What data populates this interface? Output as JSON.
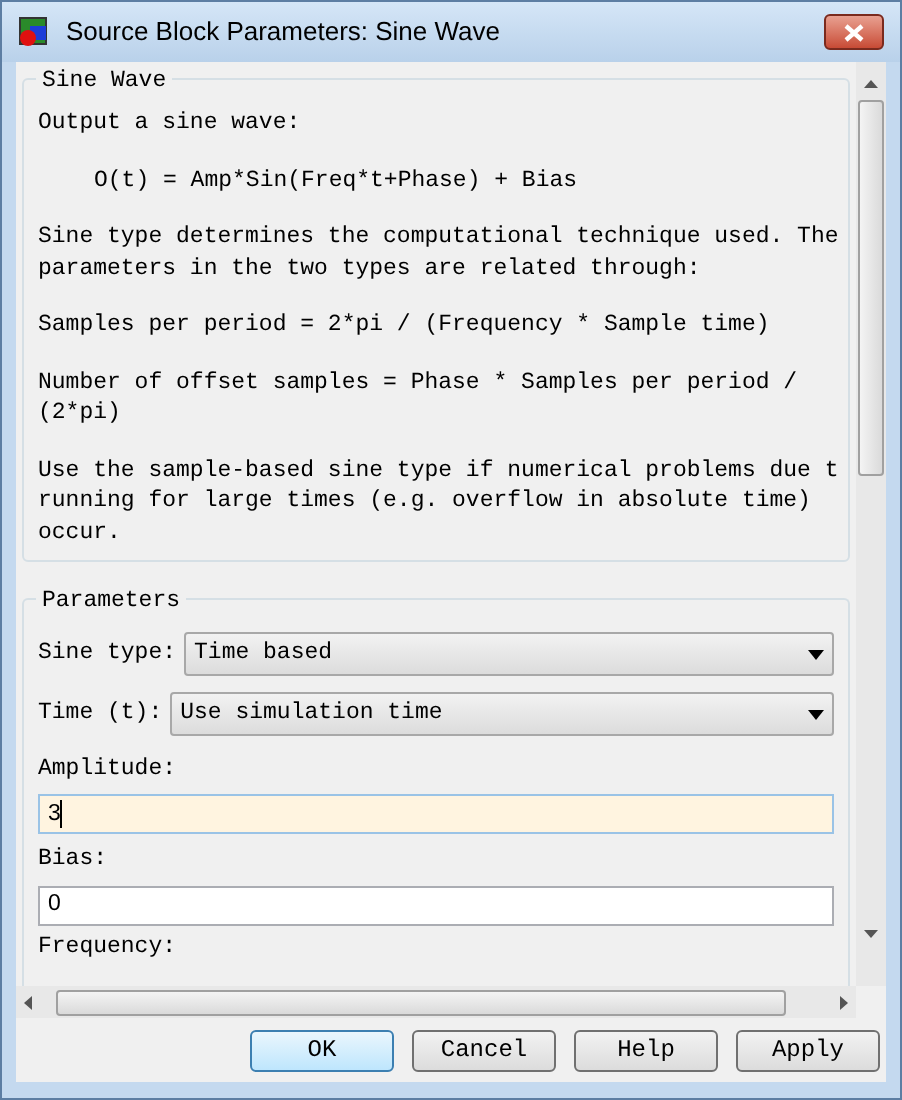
{
  "window": {
    "title": "Source Block Parameters: Sine Wave"
  },
  "description": {
    "title": "Sine Wave",
    "paragraphs": [
      {
        "kind": "text",
        "lines": [
          "Output a sine wave:"
        ]
      },
      {
        "kind": "formula",
        "lines": [
          "O(t) = Amp*Sin(Freq*t+Phase) + Bias"
        ]
      },
      {
        "kind": "text",
        "lines": [
          "Sine type determines the computational technique used. The",
          "parameters in the two types are related through:"
        ]
      },
      {
        "kind": "text",
        "lines": [
          "Samples per period = 2*pi / (Frequency * Sample time)"
        ]
      },
      {
        "kind": "text",
        "lines": [
          "Number of offset samples = Phase * Samples per period /",
          "(2*pi)"
        ]
      },
      {
        "kind": "text",
        "lines": [
          "Use the sample-based sine type if numerical problems due t",
          "running for large times (e.g. overflow in absolute time)",
          "occur."
        ]
      }
    ]
  },
  "parameters": {
    "title": "Parameters",
    "fields": [
      {
        "kind": "dropdown",
        "label": "Sine type:",
        "value": "Time based"
      },
      {
        "kind": "dropdown",
        "label": "Time (t):",
        "value": "Use simulation time"
      },
      {
        "kind": "edit",
        "label": "Amplitude:",
        "value": "3",
        "focused": true
      },
      {
        "kind": "edit",
        "label": "Bias:",
        "value": "0",
        "focused": false
      },
      {
        "kind": "label",
        "label": "Frequency:"
      }
    ]
  },
  "buttons": [
    {
      "label": "OK",
      "default": true
    },
    {
      "label": "Cancel",
      "default": false
    },
    {
      "label": "Help",
      "default": false
    },
    {
      "label": "Apply",
      "default": false
    }
  ]
}
